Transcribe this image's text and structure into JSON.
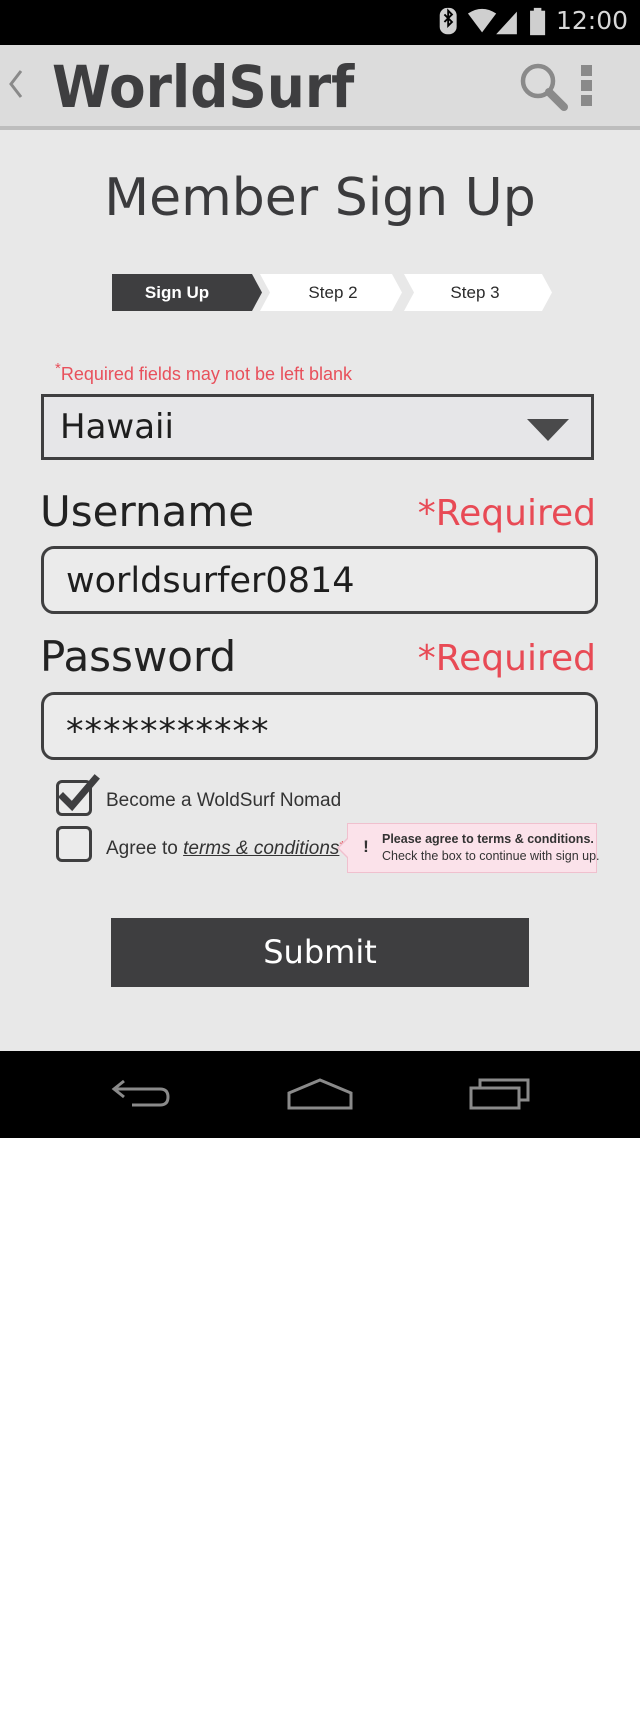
{
  "status_bar": {
    "time": "12:00",
    "icons": [
      "bluetooth-icon",
      "wifi-icon",
      "signal-icon",
      "battery-icon"
    ]
  },
  "app_bar": {
    "logo": "WorldSurf",
    "icons": [
      "back-chevron-icon",
      "search-icon",
      "overflow-menu-icon"
    ]
  },
  "page": {
    "title": "Member Sign Up"
  },
  "steps": [
    {
      "label": "Sign Up",
      "active": true
    },
    {
      "label": "Step 2",
      "active": false
    },
    {
      "label": "Step 3",
      "active": false
    }
  ],
  "form": {
    "required_note_star": "*",
    "required_note": "Required fields may not be left blank",
    "region": {
      "selected": "Hawaii"
    },
    "username": {
      "label": "Username",
      "required": "*Required",
      "value": "worldsurfer0814"
    },
    "password": {
      "label": "Password",
      "required": "*Required",
      "value": "***********"
    },
    "nomad_checkbox": {
      "label": "Become a WoldSurf Nomad",
      "checked": true
    },
    "terms_checkbox": {
      "label_prefix": "Agree to ",
      "link": "terms & conditions",
      "star": "*",
      "checked": false
    },
    "tooltip": {
      "title": "Please agree to terms & conditions.",
      "body": "Check the box to continue with sign up.",
      "icon": "!"
    },
    "submit_label": "Submit"
  },
  "nav_bar": {
    "icons": [
      "back-icon",
      "home-icon",
      "recent-apps-icon"
    ]
  },
  "colors": {
    "accent_red": "#e84a55",
    "dark": "#3e3e40",
    "background": "#e8e8e8",
    "tooltip_bg": "#fbe2ea"
  }
}
